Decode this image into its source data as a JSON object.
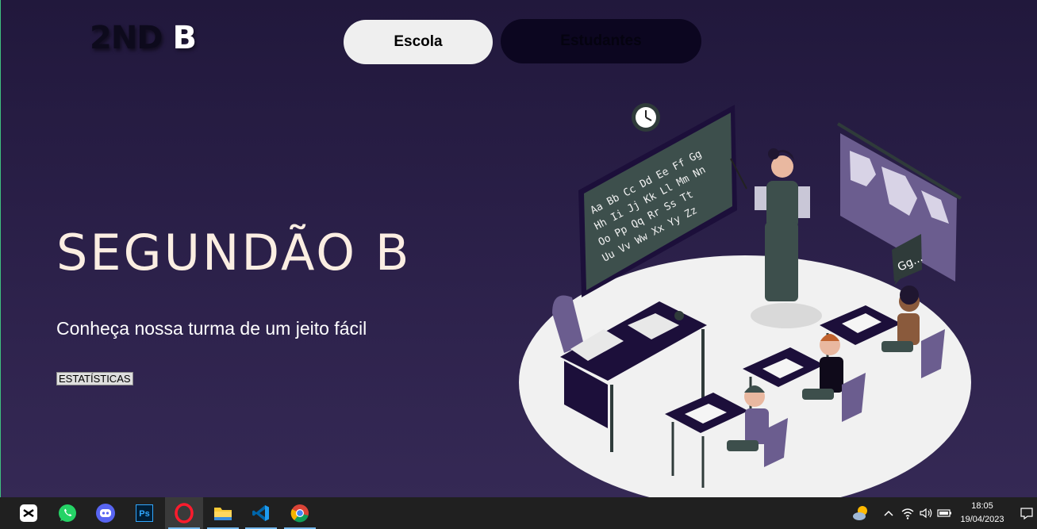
{
  "header": {
    "logo_part1": "2ND",
    "logo_part2": "B",
    "nav": [
      "Escola",
      "Estudantes"
    ]
  },
  "hero": {
    "title": "SEGUNDÃO B",
    "subtitle": "Conheça nossa turma de um jeito fácil",
    "stats_button": "ESTATÍSTICAS"
  },
  "illustration": {
    "blackboard_lines": [
      "Aa Bb Cc Dd Ee Ff Gg",
      "Hh Ii Jj Kk Ll Mm Nn",
      "Oo Pp Qq Rr Ss Tt",
      "Uu Vv Ww Xx Yy Zz"
    ],
    "speech_bubble": "Gg..."
  },
  "taskbar": {
    "apps": [
      "capcut-icon",
      "whatsapp-icon",
      "discord-icon",
      "photoshop-icon",
      "opera-icon",
      "file-explorer-icon",
      "vscode-icon",
      "chrome-icon"
    ],
    "photoshop_label": "Ps",
    "time": "18:05",
    "date": "19/04/2023"
  },
  "colors": {
    "background_top": "#21183c",
    "background_bottom": "#352955",
    "title": "#fbeee2",
    "accent_purple": "#2e1b5c"
  }
}
